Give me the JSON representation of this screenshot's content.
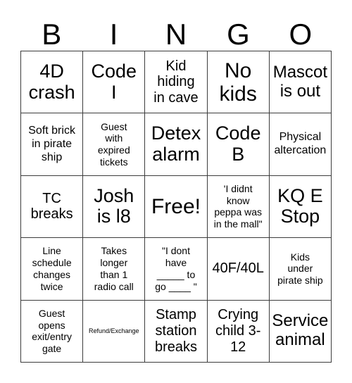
{
  "card": {
    "title": "BINGO",
    "header_letters": [
      "B",
      "I",
      "N",
      "G",
      "O"
    ],
    "grid_size": "5x5",
    "free_space_index": "row3-col3",
    "colors": {
      "text": "#000000",
      "border": "#3c3c3c",
      "background": "#ffffff"
    },
    "rows": [
      [
        {
          "text": "4D\ncrash",
          "size": "xl"
        },
        {
          "text": "Code\nI",
          "size": "xl"
        },
        {
          "text": "Kid\nhiding\nin cave",
          "size": "md"
        },
        {
          "text": "No\nkids",
          "size": "xxl"
        },
        {
          "text": "Mascot\nis out",
          "size": "lg"
        }
      ],
      [
        {
          "text": "Soft brick\nin pirate\nship",
          "size": "sm"
        },
        {
          "text": "Guest\nwith\nexpired\ntickets",
          "size": "xs"
        },
        {
          "text": "Detex\nalarm",
          "size": "xl"
        },
        {
          "text": "Code\nB",
          "size": "xl"
        },
        {
          "text": "Physical\naltercation",
          "size": "sm"
        }
      ],
      [
        {
          "text": "TC\nbreaks",
          "size": "md"
        },
        {
          "text": "Josh\nis l8",
          "size": "xl"
        },
        {
          "text": "Free!",
          "size": "xxl"
        },
        {
          "text": "'I didnt\nknow\npeppa was\nin the mall\"",
          "size": "xs"
        },
        {
          "text": "KQ E\nStop",
          "size": "xl"
        }
      ],
      [
        {
          "text": "Line\nschedule\nchanges\ntwice",
          "size": "xs"
        },
        {
          "text": "Takes\nlonger\nthan 1\nradio call",
          "size": "xs"
        },
        {
          "text": "\"I dont\nhave\n_____ to\ngo ____ \"",
          "size": "xs"
        },
        {
          "text": "40F/40L",
          "size": "md"
        },
        {
          "text": "Kids\nunder\npirate ship",
          "size": "xs"
        }
      ],
      [
        {
          "text": "Guest\nopens\nexit/entry\ngate",
          "size": "xs"
        },
        {
          "text": "Refund/Exchange",
          "size": "xxs"
        },
        {
          "text": "Stamp\nstation\nbreaks",
          "size": "md"
        },
        {
          "text": "Crying\nchild 3-\n12",
          "size": "md"
        },
        {
          "text": "Service\nanimal",
          "size": "lg"
        }
      ]
    ]
  }
}
